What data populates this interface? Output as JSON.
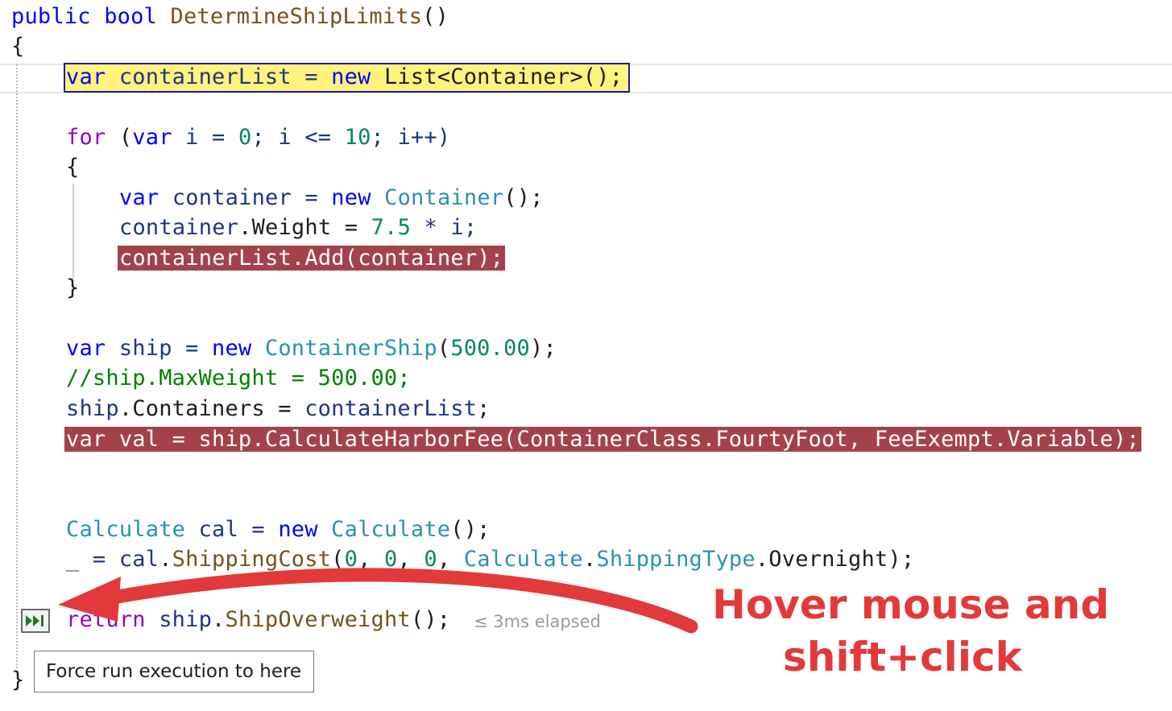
{
  "method_signature": {
    "kw_public": "public",
    "kw_bool": "bool",
    "name": "DetermineShipLimits",
    "parens": "()"
  },
  "brace_open": "{",
  "brace_close": "}",
  "lines": {
    "l3": {
      "kw_var": "var",
      "rest1": " containerList = ",
      "kw_new": "new",
      "rest2": " List<Container>();"
    },
    "l4": {
      "kw_for": "for",
      "p1": " (",
      "kw_var": "var",
      "p2": " i = ",
      "n0": "0",
      "p3": "; i <= ",
      "n10": "10",
      "p4": "; i++)"
    },
    "l5": "{",
    "l6": {
      "kw_var": "var",
      "p1": " container = ",
      "kw_new": "new",
      "sp": " ",
      "type": "Container",
      "p2": "();"
    },
    "l7": {
      "ident": "container",
      "p1": ".Weight = ",
      "num": "7.5",
      "p2": " * i;"
    },
    "l8": "containerList.Add(container);",
    "l9": "}",
    "l10": {
      "kw_var": "var",
      "p1": " ship = ",
      "kw_new": "new",
      "sp": " ",
      "type": "ContainerShip",
      "p2": "(",
      "num": "500.00",
      "p3": ");"
    },
    "l11": {
      "comment": "//ship.MaxWeight = 500.00;"
    },
    "l12": {
      "ident": "ship",
      "p1": ".Containers = ",
      "ident2": "containerList",
      "p2": ";"
    },
    "l13": "var val = ship.CalculateHarborFee(ContainerClass.FourtyFoot, FeeExempt.Variable);",
    "l14": {
      "type": "Calculate",
      "p1": " cal = ",
      "kw_new": "new",
      "sp": " ",
      "type2": "Calculate",
      "p2": "();"
    },
    "l15": {
      "p0": "_ = ",
      "ident": "cal",
      "p1": ".",
      "method": "ShippingCost",
      "p2": "(",
      "n1": "0",
      "c1": ", ",
      "n2": "0",
      "c2": ", ",
      "n3": "0",
      "c3": ", ",
      "type": "Calculate",
      "dot": ".",
      "type2": "ShippingType",
      "p3": ".Overnight);"
    },
    "l16": {
      "kw_return": "return",
      "p1": " ",
      "ident": "ship",
      "p2": ".",
      "method": "ShipOverweight",
      "p3": "();"
    }
  },
  "elapsed_label": "≤ 3ms elapsed",
  "tooltip_text": "Force run execution to here",
  "annotation": {
    "line1": "Hover mouse and",
    "line2": "shift+click"
  },
  "icons": {
    "run_to_here": "run-execution-to-here-icon",
    "arrow": "red-curved-arrow"
  },
  "colors": {
    "breakpoint": "#a4424c",
    "current_statement": "#fff27d",
    "annotation": "#e23a3a",
    "keyword": "#0000ff",
    "type": "#2b91af"
  }
}
